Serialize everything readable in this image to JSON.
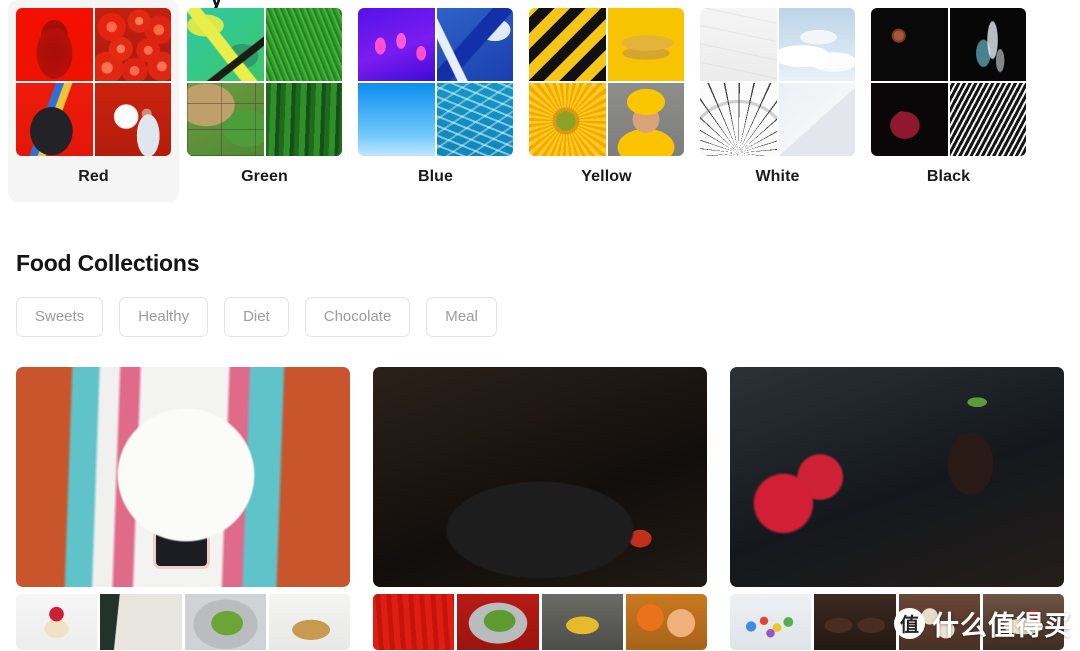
{
  "page": {
    "background": "#ffffff",
    "cut_heading_fragment": "y"
  },
  "color_collections": {
    "active_index": 0,
    "items": [
      {
        "label": "Red",
        "accent": "#ef1200",
        "tiles": [
          "red-building-photo",
          "tomatoes-photo",
          "red-skateboarder-photo",
          "red-balloon-girl-photo"
        ]
      },
      {
        "label": "Green",
        "accent": "#35a82e",
        "tiles": [
          "green-paint-photo",
          "green-grass-photo",
          "mossy-stone-wall-photo",
          "cactus-photo"
        ]
      },
      {
        "label": "Blue",
        "accent": "#1b3fae",
        "tiles": [
          "blue-jellyfish-photo",
          "blue-paint-photo",
          "blue-sky-gradient-photo",
          "pool-water-photo"
        ]
      },
      {
        "label": "Yellow",
        "accent": "#f6c400",
        "tiles": [
          "yellow-hazard-stripes-photo",
          "bananas-photo",
          "sunflower-photo",
          "yellow-beanie-girl-photo"
        ]
      },
      {
        "label": "White",
        "accent": "#f2f2f2",
        "tiles": [
          "white-plaster-wall-photo",
          "white-clouds-photo",
          "white-ferris-wheel-photo",
          "white-wall-corner-photo"
        ]
      },
      {
        "label": "Black",
        "accent": "#0a0a0a",
        "tiles": [
          "blood-moon-photo",
          "blue-smoke-photo",
          "dark-figure-photo",
          "open-book-photo"
        ]
      }
    ]
  },
  "food_section": {
    "heading": "Food Collections",
    "chips": [
      {
        "label": "Sweets"
      },
      {
        "label": "Healthy"
      },
      {
        "label": "Diet"
      },
      {
        "label": "Chocolate"
      },
      {
        "label": "Meal"
      }
    ],
    "chip_text_color": "#9b9b9b",
    "chip_border_color": "#e3e3e3",
    "cards": [
      {
        "hero": "phone-photographing-plate-photo",
        "thumbs": [
          "cupcake-photo",
          "cafe-table-photo",
          "avocado-toast-egg-photo",
          "granola-photo"
        ]
      },
      {
        "hero": "salad-bowl-photo",
        "thumbs": [
          "strawberries-crate-photo",
          "salad-toast-photo",
          "banana-basket-photo",
          "oranges-photo"
        ]
      },
      {
        "hero": "chocolate-raspberries-photo",
        "thumbs": [
          "candy-bowl-photo",
          "brownie-cakes-photo",
          "truffle-muffins-photo",
          "dessert-plate-photo"
        ]
      }
    ]
  },
  "watermark": {
    "badge": "值",
    "text": "什么值得买"
  }
}
